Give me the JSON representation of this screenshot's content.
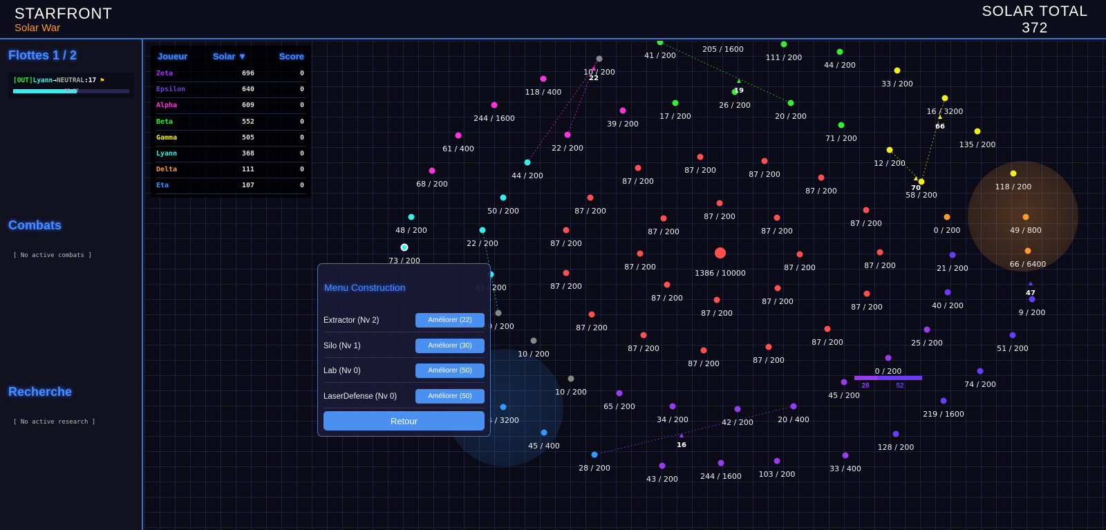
{
  "header": {
    "title": "STARFRONT",
    "subtitle": "Solar War",
    "solar_total_label": "SOLAR TOTAL",
    "solar_total_value": "372"
  },
  "sidebar": {
    "fleets_title": "Flottes 1 / 2",
    "fleet": {
      "tag": "[OUT]",
      "from": "Lyann",
      "arrow": "→",
      "to": "NEUTRAL",
      "count": ":17",
      "flag_icon": "flag-icon",
      "time": "00:12",
      "progress": 0.55
    },
    "combats_title": "Combats",
    "combats_empty": "[ No active combats ]",
    "research_title": "Recherche",
    "research_empty": "[ No active research ]"
  },
  "scoreboard": {
    "headers": {
      "player": "Joueur",
      "solar": "Solar ▼",
      "score": "Score"
    },
    "rows": [
      {
        "name": "Zeta",
        "solar": "696",
        "score": "0",
        "color": "#9b3bf0"
      },
      {
        "name": "Epsilon",
        "solar": "640",
        "score": "0",
        "color": "#6a3cf5"
      },
      {
        "name": "Alpha",
        "solar": "609",
        "score": "0",
        "color": "#ff33dd"
      },
      {
        "name": "Beta",
        "solar": "552",
        "score": "0",
        "color": "#33ee33"
      },
      {
        "name": "Gamma",
        "solar": "505",
        "score": "0",
        "color": "#eeee22"
      },
      {
        "name": "Lyann",
        "solar": "368",
        "score": "0",
        "color": "#33eeee"
      },
      {
        "name": "Delta",
        "solar": "111",
        "score": "0",
        "color": "#ff9933"
      },
      {
        "name": "Eta",
        "solar": "107",
        "score": "0",
        "color": "#3399ff"
      }
    ]
  },
  "construction_menu": {
    "title": "Menu Construction",
    "items": [
      {
        "label": "Extractor (Nv 2)",
        "button": "Améliorer (22)"
      },
      {
        "label": "Silo (Nv 1)",
        "button": "Améliorer (30)"
      },
      {
        "label": "Lab (Nv 0)",
        "button": "Améliorer (50)"
      },
      {
        "label": "LaserDefense (Nv 0)",
        "button": "Améliorer (50)"
      }
    ],
    "back": "Retour"
  },
  "map": {
    "owner_colors": {
      "Zeta": "#9b3bf0",
      "Epsilon": "#6a3cf5",
      "Alpha": "#ff33dd",
      "Beta": "#33ee33",
      "Gamma": "#eeee22",
      "Lyann": "#33eeee",
      "Delta": "#ff9933",
      "Eta": "#3399ff",
      "neutral": "#888888",
      "red": "#ff5050"
    },
    "planets": [
      {
        "owner": "Beta",
        "label": "41 / 200"
      },
      {
        "owner": "Beta",
        "label": "205 / 1600"
      },
      {
        "owner": "Beta",
        "label": "111 / 200"
      },
      {
        "owner": "Beta",
        "label": "44 / 200"
      },
      {
        "owner": "Gamma",
        "label": "33 / 200"
      },
      {
        "owner": "neutral",
        "label": "10 / 200"
      },
      {
        "owner": "Alpha",
        "label": "118 / 400"
      },
      {
        "owner": "Alpha",
        "label": "244 / 1600"
      },
      {
        "owner": "Alpha",
        "label": "61 / 400"
      },
      {
        "owner": "Alpha",
        "label": "68 / 200"
      },
      {
        "owner": "Alpha",
        "label": "39 / 200"
      },
      {
        "owner": "Alpha",
        "label": "22 / 200"
      },
      {
        "owner": "Beta",
        "label": "17 / 200"
      },
      {
        "owner": "Beta",
        "label": "26 / 200"
      },
      {
        "owner": "Beta",
        "label": "20 / 200"
      },
      {
        "owner": "Beta",
        "label": "71 / 200"
      },
      {
        "owner": "Gamma",
        "label": "16 / 3200"
      },
      {
        "owner": "Gamma",
        "label": "135 / 200"
      },
      {
        "owner": "Gamma",
        "label": "12 / 200"
      },
      {
        "owner": "Gamma",
        "label": "58 / 200"
      },
      {
        "owner": "Gamma",
        "label": "118 / 200"
      },
      {
        "owner": "Delta",
        "label": "49 / 800"
      },
      {
        "owner": "Delta",
        "label": "0 / 200"
      },
      {
        "owner": "Delta",
        "label": "66 / 6400"
      },
      {
        "owner": "Epsilon",
        "label": "21 / 200"
      },
      {
        "owner": "Epsilon",
        "label": "40 / 200"
      },
      {
        "owner": "Epsilon",
        "label": "9 / 200"
      },
      {
        "owner": "Epsilon",
        "label": "51 / 200"
      },
      {
        "owner": "Zeta",
        "label": "25 / 200"
      },
      {
        "owner": "Zeta",
        "label": "0 / 200"
      },
      {
        "owner": "Zeta",
        "label": "45 / 200"
      },
      {
        "owner": "Epsilon",
        "label": "74 / 200"
      },
      {
        "owner": "Epsilon",
        "label": "219 / 1600"
      },
      {
        "owner": "Epsilon",
        "label": "128 / 200"
      },
      {
        "owner": "Zeta",
        "label": "33 / 400"
      },
      {
        "owner": "Zeta",
        "label": "103 / 200"
      },
      {
        "owner": "Zeta",
        "label": "244 / 1600"
      },
      {
        "owner": "Zeta",
        "label": "43 / 200"
      },
      {
        "owner": "Eta",
        "label": "28 / 200"
      },
      {
        "owner": "Eta",
        "label": "45 / 400"
      },
      {
        "owner": "Eta",
        "label": "4 / 3200"
      },
      {
        "owner": "Zeta",
        "label": "20 / 400"
      },
      {
        "owner": "Zeta",
        "label": "42 / 200"
      },
      {
        "owner": "Zeta",
        "label": "34 / 200"
      },
      {
        "owner": "Zeta",
        "label": "65 / 200"
      },
      {
        "owner": "neutral",
        "label": "10 / 200"
      },
      {
        "owner": "neutral",
        "label": "10 / 200"
      },
      {
        "owner": "neutral",
        "label": "10 / 200"
      },
      {
        "owner": "Lyann",
        "label": "44 / 200"
      },
      {
        "owner": "Lyann",
        "label": "50 / 200"
      },
      {
        "owner": "Lyann",
        "label": "22 / 200"
      },
      {
        "owner": "Lyann",
        "label": "48 / 200"
      },
      {
        "owner": "Lyann",
        "label": "73 / 200"
      },
      {
        "owner": "Lyann",
        "label": "43 / 200"
      },
      {
        "owner": "red",
        "label": "87 / 200"
      },
      {
        "owner": "red",
        "label": "87 / 200"
      },
      {
        "owner": "red",
        "label": "87 / 200"
      },
      {
        "owner": "red",
        "label": "87 / 200"
      },
      {
        "owner": "red",
        "label": "87 / 200"
      },
      {
        "owner": "red",
        "label": "87 / 200"
      },
      {
        "owner": "red",
        "label": "87 / 200"
      },
      {
        "owner": "red",
        "label": "87 / 200"
      },
      {
        "owner": "red",
        "label": "87 / 200"
      },
      {
        "owner": "red",
        "label": "87 / 200"
      },
      {
        "owner": "red",
        "label": "87 / 200"
      },
      {
        "owner": "red",
        "label": "1386 / 10000"
      },
      {
        "owner": "red",
        "label": "87 / 200"
      },
      {
        "owner": "red",
        "label": "87 / 200"
      },
      {
        "owner": "red",
        "label": "87 / 200"
      },
      {
        "owner": "red",
        "label": "87 / 200"
      },
      {
        "owner": "red",
        "label": "87 / 200"
      },
      {
        "owner": "red",
        "label": "87 / 200"
      },
      {
        "owner": "red",
        "label": "87 / 200"
      },
      {
        "owner": "red",
        "label": "87 / 200"
      },
      {
        "owner": "red",
        "label": "87 / 200"
      },
      {
        "owner": "red",
        "label": "87 / 200"
      },
      {
        "owner": "red",
        "label": "87 / 200"
      },
      {
        "owner": "red",
        "label": "87 / 200"
      }
    ],
    "fleets": [
      {
        "count": "22",
        "owner": "Alpha"
      },
      {
        "count": "19",
        "owner": "Beta"
      },
      {
        "count": "66",
        "owner": "Gamma"
      },
      {
        "count": "70",
        "owner": "Gamma"
      },
      {
        "count": "47",
        "owner": "Epsilon"
      },
      {
        "count": "16",
        "owner": "Zeta"
      }
    ],
    "combat": {
      "attacker": "28",
      "defender": "52",
      "attacker_color": "#9b3bf0",
      "defender_color": "#6a3cf5",
      "attacker_share": 0.35
    }
  }
}
